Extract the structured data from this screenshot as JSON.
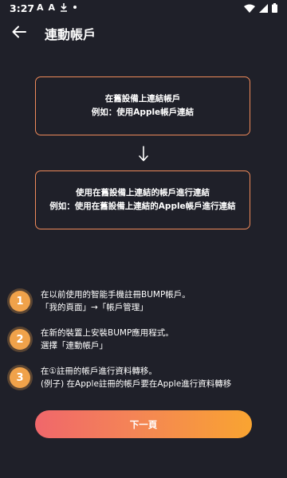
{
  "status_bar": {
    "time": "3:27",
    "left_icons": [
      "A",
      "A"
    ]
  },
  "header": {
    "title": "連動帳戶"
  },
  "flow": {
    "box1": {
      "line1": "在舊設備上連結帳戶",
      "line2": "例如：使用Apple帳戶連結"
    },
    "box2": {
      "line1": "使用在舊設備上連結的帳戶進行連結",
      "line2": "例如：使用在舊設備上連結的Apple帳戶進行連結"
    }
  },
  "steps": [
    {
      "number": "1",
      "line1": "在以前使用的智能手機註冊BUMP帳戶。",
      "line2": "「我的頁面」→「帳戶管理」"
    },
    {
      "number": "2",
      "line1": "在新的裝置上安裝BUMP應用程式。",
      "line2": "選擇「連動帳戶」"
    },
    {
      "number": "3",
      "line1": "在①註冊的帳戶進行資料轉移。",
      "line2": "(例子) 在Apple註冊的帳戶要在Apple進行資料轉移"
    }
  ],
  "next_button": {
    "label": "下一頁"
  },
  "colors": {
    "background": "#1f2029",
    "box_border": "#ef8a5a",
    "badge": "#f0a24a",
    "button_gradient_start": "#f0676b",
    "button_gradient_end": "#f9a431"
  }
}
